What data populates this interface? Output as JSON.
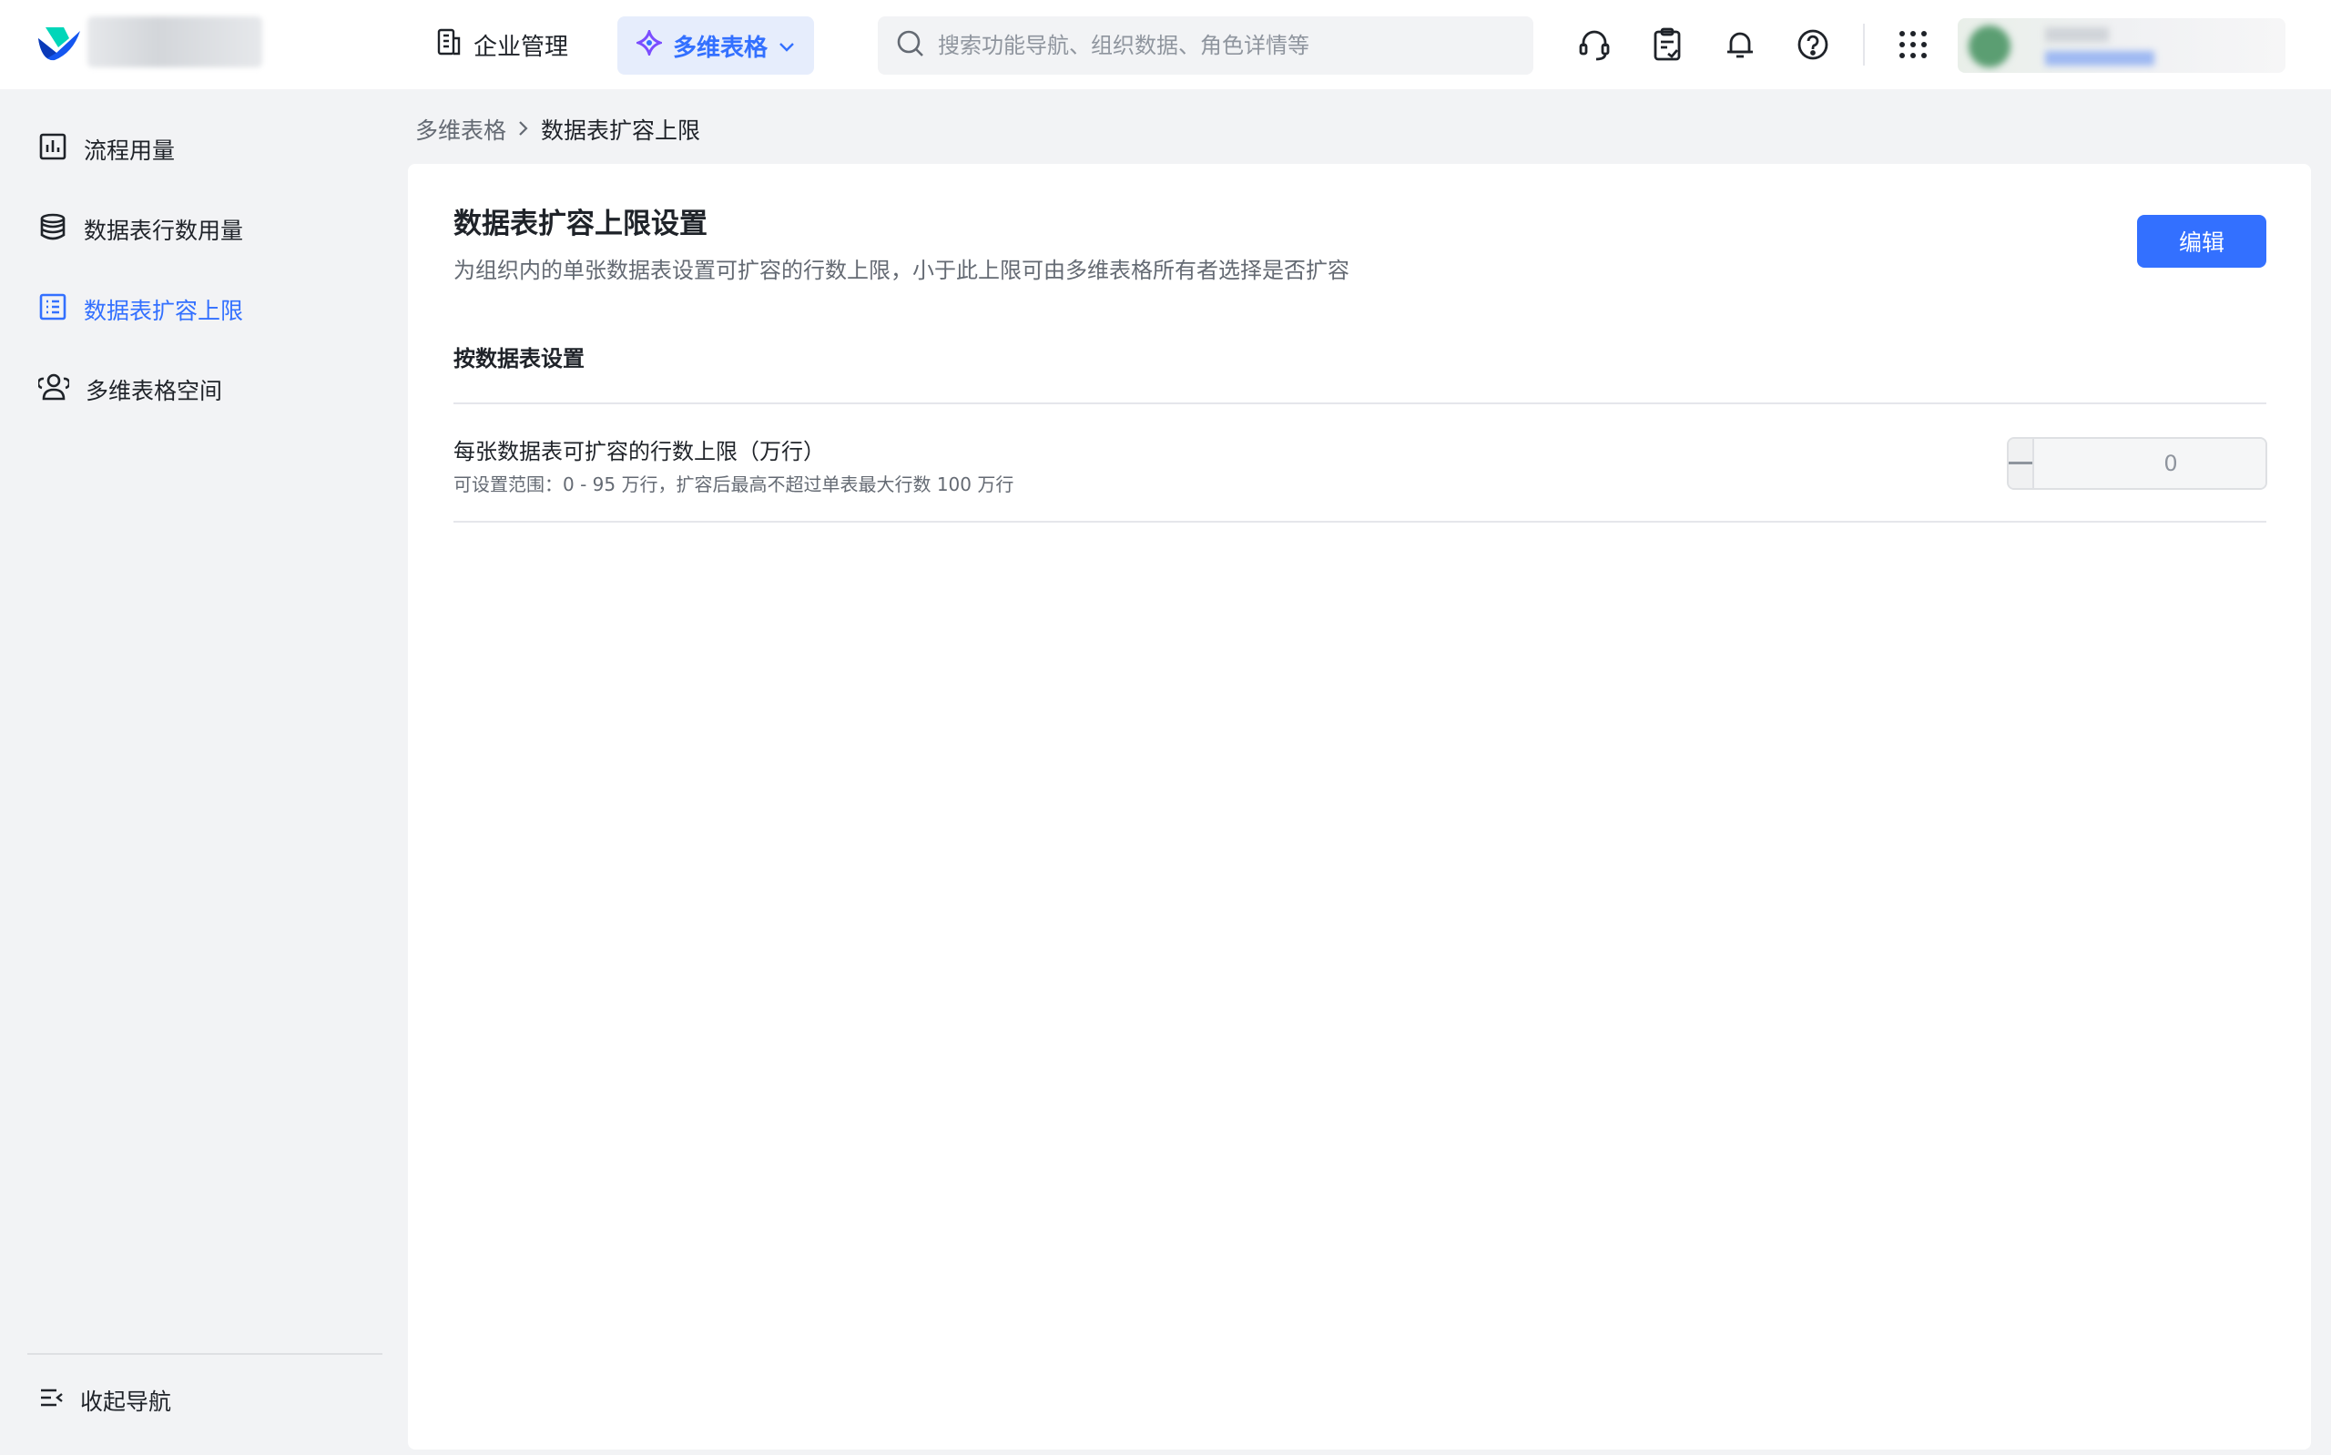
{
  "colors": {
    "accent": "#3370ff",
    "text": "#1f2329",
    "muted": "#646a73",
    "bg": "#f2f3f5"
  },
  "topbar": {
    "enterprise_label": "企业管理",
    "product_label": "多维表格",
    "search_placeholder": "搜索功能导航、组织数据、角色详情等",
    "icons": [
      "headset-icon",
      "clipboard-check-icon",
      "bell-icon",
      "help-icon",
      "apps-grid-icon"
    ]
  },
  "sidebar": {
    "items": [
      {
        "label": "流程用量",
        "icon": "bar-chart-icon"
      },
      {
        "label": "数据表行数用量",
        "icon": "database-icon"
      },
      {
        "label": "数据表扩容上限",
        "icon": "table-list-icon",
        "active": true
      },
      {
        "label": "多维表格空间",
        "icon": "users-icon"
      }
    ],
    "collapse_label": "收起导航"
  },
  "breadcrumb": {
    "parent": "多维表格",
    "current": "数据表扩容上限"
  },
  "main": {
    "title": "数据表扩容上限设置",
    "description": "为组织内的单张数据表设置可扩容的行数上限，小于此上限可由多维表格所有者选择是否扩容",
    "edit_label": "编辑",
    "section_title": "按数据表设置",
    "setting": {
      "label": "每张数据表可扩容的行数上限（万行）",
      "hint": "可设置范围：0 - 95 万行，扩容后最高不超过单表最大行数 100 万行",
      "value": "0"
    }
  }
}
